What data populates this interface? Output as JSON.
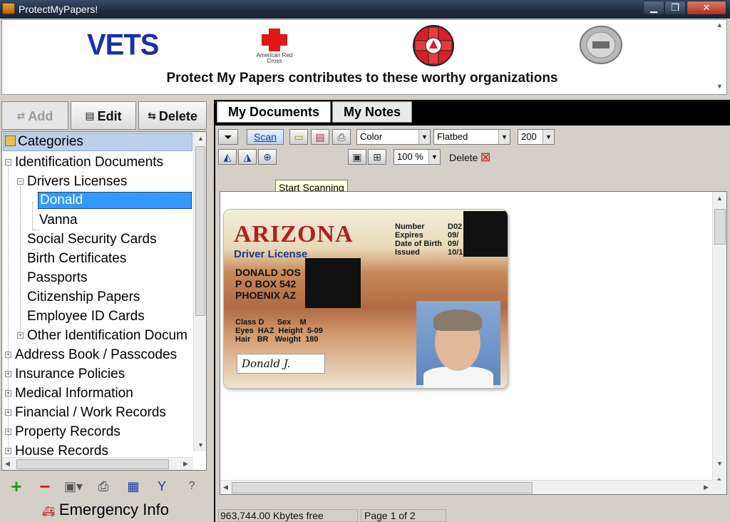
{
  "window": {
    "title": "ProtectMyPapers!",
    "minimize": "▁",
    "restore": "❐",
    "close": "✕"
  },
  "banner": {
    "vets_logo": "VETS",
    "redcross_text": "American Red Cross",
    "caption": "Protect My Papers contributes to these worthy organizations"
  },
  "toolbar_left": {
    "add_label": "Add",
    "edit_label": "Edit",
    "delete_label": "Delete"
  },
  "tree": {
    "header": "Categories",
    "items": [
      {
        "label": "Identification Documents",
        "level": 0,
        "expander": "−"
      },
      {
        "label": "Drivers Licenses",
        "level": 1,
        "expander": "−"
      },
      {
        "label": "Donald",
        "level": 2,
        "selected": true
      },
      {
        "label": "Vanna",
        "level": 2
      },
      {
        "label": "Social Security Cards",
        "level": 1
      },
      {
        "label": "Birth Certificates",
        "level": 1
      },
      {
        "label": "Passports",
        "level": 1
      },
      {
        "label": "Citizenship Papers",
        "level": 1
      },
      {
        "label": "Employee ID Cards",
        "level": 1
      },
      {
        "label": "Other Identification Docum",
        "level": 1,
        "expander": "+"
      },
      {
        "label": "Address Book / Passcodes",
        "level": 0,
        "expander": "+"
      },
      {
        "label": "Insurance Policies",
        "level": 0,
        "expander": "+"
      },
      {
        "label": "Medical Information",
        "level": 0,
        "expander": "+"
      },
      {
        "label": "Financial / Work Records",
        "level": 0,
        "expander": "+"
      },
      {
        "label": "Property Records",
        "level": 0,
        "expander": "+"
      },
      {
        "label": "House Records",
        "level": 0,
        "expander": "+"
      }
    ]
  },
  "bottom_icons": [
    "plus-icon",
    "minus-icon",
    "scanner-icon",
    "print-icon",
    "save-icon",
    "tools-icon",
    "help-icon"
  ],
  "emergency": {
    "label": "Emergency Info"
  },
  "tabs": {
    "documents": "My Documents",
    "notes": "My Notes"
  },
  "doc_toolbar": {
    "scan_label": "Scan",
    "color_mode": "Color",
    "source": "Flatbed",
    "dpi": "200",
    "zoom": "100 %",
    "delete_label": "Delete",
    "tooltip": "Start Scanning"
  },
  "license": {
    "state": "ARIZONA",
    "subtitle": "Driver License",
    "field_labels": [
      "Number",
      "Expires",
      "Date of Birth",
      "Issued"
    ],
    "field_values": [
      "D02",
      "09/",
      "09/",
      "10/1"
    ],
    "name_lines": [
      "DONALD JOS",
      "P O BOX 542",
      "PHOENIX AZ"
    ],
    "misc_lines": [
      "Class D      Sex    M",
      "Eyes  HAZ  Height  5-09",
      "Hair   BR   Weight  180"
    ],
    "signature": "Donald J."
  },
  "status": {
    "free_space": "963,744.00 Kbytes free",
    "page": "Page 1 of 2"
  }
}
